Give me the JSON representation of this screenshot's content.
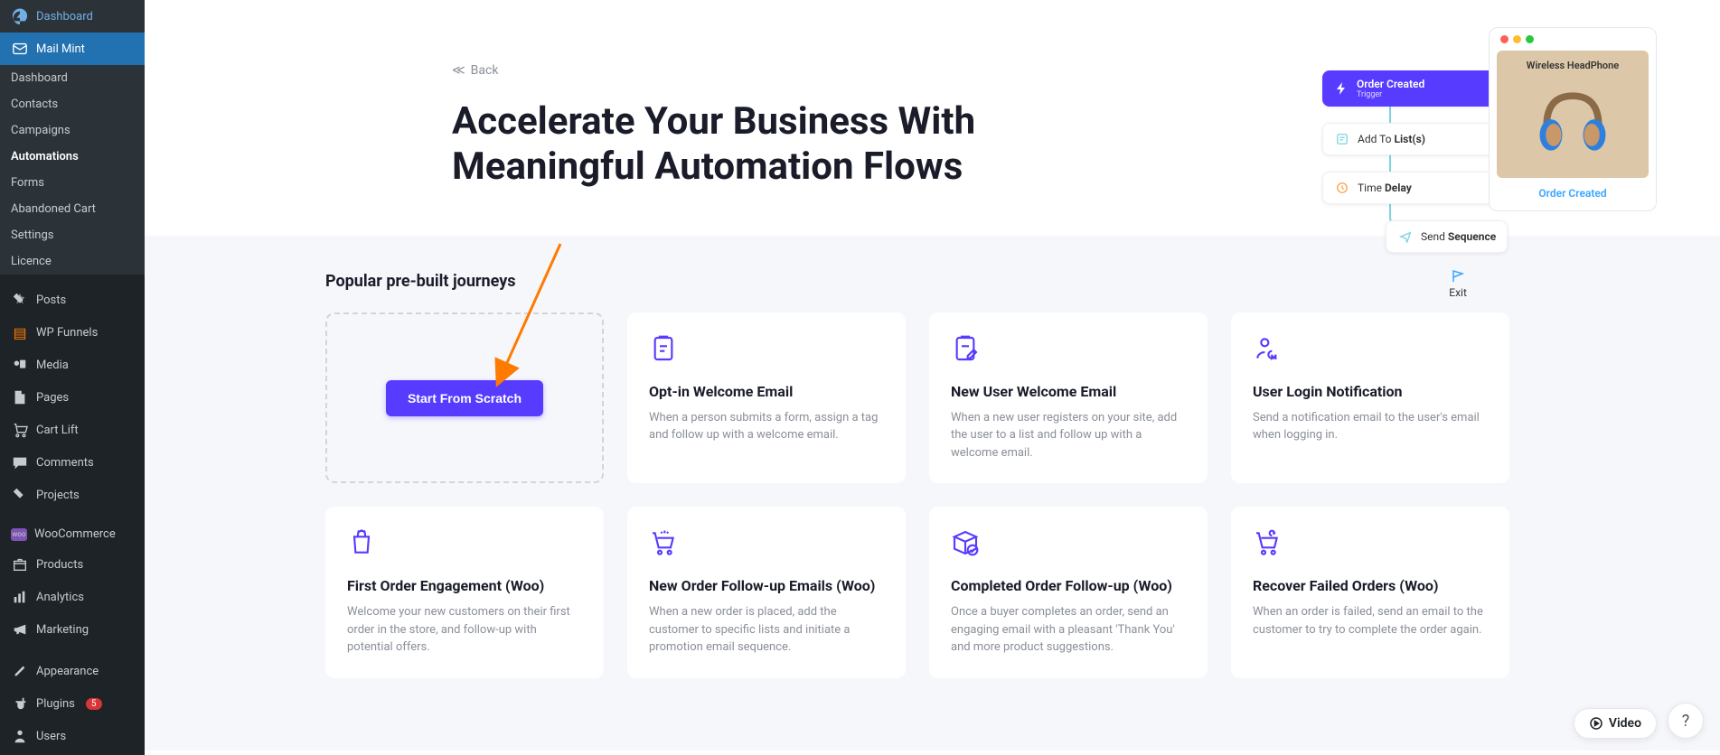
{
  "sidebar": {
    "items": [
      {
        "label": "Dashboard",
        "icon": "gauge"
      },
      {
        "label": "Mail Mint",
        "icon": "mail",
        "active": true
      },
      {
        "label": "Posts",
        "icon": "pin"
      },
      {
        "label": "WP Funnels",
        "icon": "layers"
      },
      {
        "label": "Media",
        "icon": "media"
      },
      {
        "label": "Pages",
        "icon": "page"
      },
      {
        "label": "Cart Lift",
        "icon": "cart"
      },
      {
        "label": "Comments",
        "icon": "comment"
      },
      {
        "label": "Projects",
        "icon": "pin"
      },
      {
        "label": "WooCommerce",
        "icon": "woo"
      },
      {
        "label": "Products",
        "icon": "box"
      },
      {
        "label": "Analytics",
        "icon": "chart"
      },
      {
        "label": "Marketing",
        "icon": "mega"
      },
      {
        "label": "Appearance",
        "icon": "brush"
      },
      {
        "label": "Plugins",
        "icon": "plug",
        "badge": "5"
      },
      {
        "label": "Users",
        "icon": "user"
      }
    ],
    "sub": [
      {
        "label": "Dashboard"
      },
      {
        "label": "Contacts"
      },
      {
        "label": "Campaigns"
      },
      {
        "label": "Automations",
        "current": true
      },
      {
        "label": "Forms"
      },
      {
        "label": "Abandoned Cart"
      },
      {
        "label": "Settings"
      },
      {
        "label": "Licence"
      }
    ]
  },
  "hero": {
    "back": "Back",
    "title_line1": "Accelerate Your Business With",
    "title_line2": "Meaningful Automation Flows"
  },
  "diagram": {
    "product_title": "Wireless HeadPhone",
    "order_created": "Order Created",
    "nodes": {
      "order_created_label": "Order Created",
      "order_created_sub": "Trigger",
      "add_to": "Add To",
      "add_to_bold": "List(s)",
      "time": "Time",
      "time_bold": "Delay",
      "send": "Send",
      "send_bold": "Sequence",
      "exit": "Exit"
    }
  },
  "section": {
    "title": "Popular pre-built journeys",
    "scratch_btn": "Start From Scratch",
    "cards": [
      {
        "title": "Opt-in Welcome Email",
        "desc": "When a person submits a form, assign a tag and follow up with a welcome email."
      },
      {
        "title": "New User Welcome Email",
        "desc": "When a new user registers on your site, add the user to a list and follow up with a welcome email."
      },
      {
        "title": "User Login Notification",
        "desc": "Send a notification email to the user's email when logging in."
      },
      {
        "title": "First Order Engagement (Woo)",
        "desc": "Welcome your new customers on their first order in the store, and follow-up with potential offers."
      },
      {
        "title": "New Order Follow-up Emails (Woo)",
        "desc": "When a new order is placed, add the customer to specific lists and initiate a promotion email sequence."
      },
      {
        "title": "Completed Order Follow-up (Woo)",
        "desc": "Once a buyer completes an order, send an engaging email with a pleasant 'Thank You' and more product suggestions."
      },
      {
        "title": "Recover Failed Orders (Woo)",
        "desc": "When an order is failed, send an email to the customer to try to complete the order again."
      }
    ]
  },
  "float": {
    "video": "Video",
    "help": "?"
  }
}
